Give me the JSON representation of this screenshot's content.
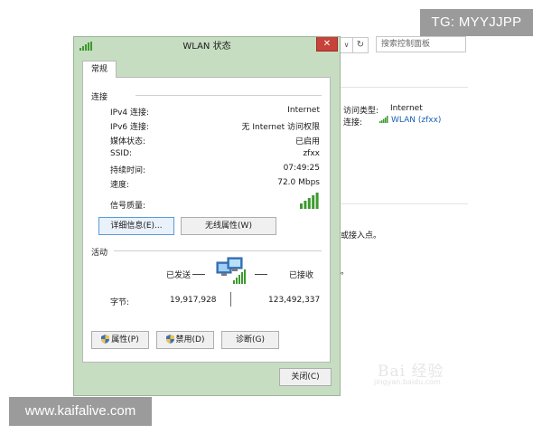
{
  "watermarks": {
    "tg": "TG: MYYJJPP",
    "site": "www.kaifalive.com",
    "baidu": "Bai 经验",
    "baidu_url": "jingyan.baidu.com"
  },
  "background": {
    "dropdown_glyph": "∨",
    "refresh_glyph": "↻",
    "search_placeholder": "搜索控制面板",
    "access_type_label": "访问类型:",
    "access_type_value": "Internet",
    "connection_label": "连接:",
    "connection_link": "WLAN (zfxx)",
    "partial_text_1": "或接入点。",
    "partial_text_2": "。"
  },
  "dialog": {
    "title": "WLAN 状态",
    "close_glyph": "✕",
    "tab_general": "常规",
    "connection_group": "连接",
    "rows": [
      {
        "label": "IPv4 连接:",
        "value": "Internet"
      },
      {
        "label": "IPv6 连接:",
        "value": "无 Internet 访问权限"
      },
      {
        "label": "媒体状态:",
        "value": "已启用"
      },
      {
        "label": "SSID:",
        "value": "zfxx"
      },
      {
        "label": "持续时间:",
        "value": "07:49:25"
      },
      {
        "label": "速度:",
        "value": "72.0 Mbps"
      }
    ],
    "signal_label": "信号质量:",
    "signal_bars": 5,
    "details_button": "详细信息(E)...",
    "wireless_props_button": "无线属性(W)",
    "activity_group": "活动",
    "sent_label": "已发送",
    "received_label": "已接收",
    "bytes_label": "字节:",
    "bytes_sent": "19,917,928",
    "bytes_received": "123,492,337",
    "properties_button": "属性(P)",
    "disable_button": "禁用(D)",
    "diagnose_button": "诊断(G)",
    "close_button": "关闭(C)"
  },
  "colors": {
    "dialog_frame": "#c7ddc2",
    "close_red": "#c7423a",
    "signal_green": "#3c9a2e",
    "link_blue": "#1a5fb4"
  }
}
